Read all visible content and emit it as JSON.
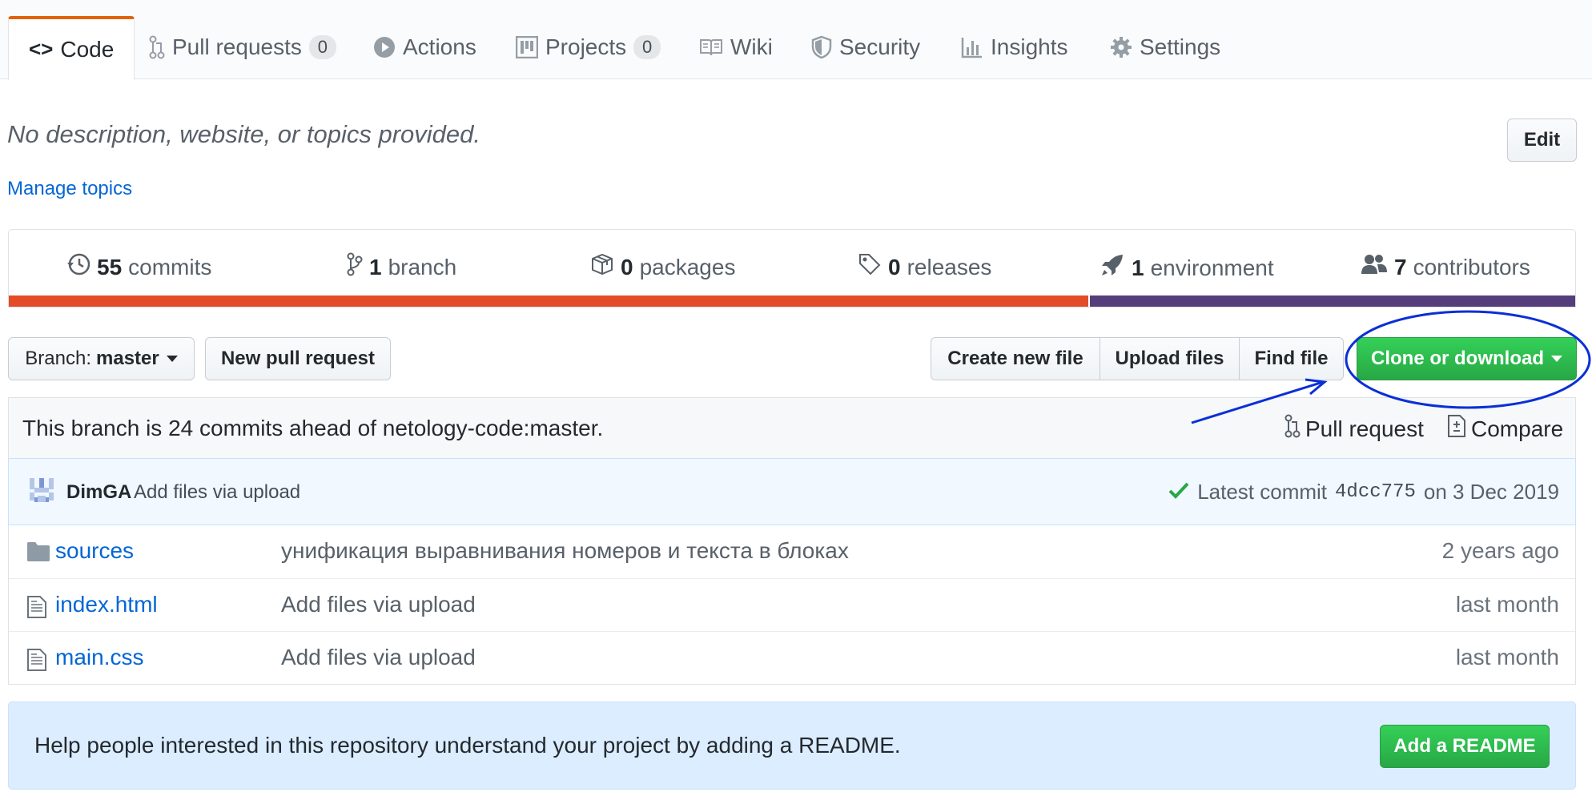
{
  "tabs": [
    {
      "label": "Code"
    },
    {
      "label": "Pull requests",
      "count": "0"
    },
    {
      "label": "Actions"
    },
    {
      "label": "Projects",
      "count": "0"
    },
    {
      "label": "Wiki"
    },
    {
      "label": "Security"
    },
    {
      "label": "Insights"
    },
    {
      "label": "Settings"
    }
  ],
  "repo": {
    "description": "No description, website, or topics provided.",
    "edit_label": "Edit",
    "manage_topics": "Manage topics"
  },
  "summary": {
    "commits": {
      "count": "55",
      "label": "commits"
    },
    "branches": {
      "count": "1",
      "label": "branch"
    },
    "packages": {
      "count": "0",
      "label": "packages"
    },
    "releases": {
      "count": "0",
      "label": "releases"
    },
    "environments": {
      "count": "1",
      "label": "environment"
    },
    "contributors": {
      "count": "7",
      "label": "contributors"
    },
    "languages": [
      {
        "color": "#e34c26",
        "share": 0.69
      },
      {
        "color": "#563d7c",
        "share": 0.31
      }
    ]
  },
  "actions": {
    "branch_prefix": "Branch:",
    "branch_name": "master",
    "new_pull_request": "New pull request",
    "create_new_file": "Create new file",
    "upload_files": "Upload files",
    "find_file": "Find file",
    "clone_or_download": "Clone or download"
  },
  "tracking": {
    "text": "This branch is 24 commits ahead of netology-code:master.",
    "pull_request": "Pull request",
    "compare": "Compare"
  },
  "commit": {
    "author": "DimGA",
    "message": "Add files via upload",
    "latest_prefix": "Latest commit",
    "sha": "4dcc775",
    "date": "on 3 Dec 2019"
  },
  "files": [
    {
      "type": "folder",
      "name": "sources",
      "message": "унификация выравнивания номеров и текста в блоках",
      "age": "2 years ago"
    },
    {
      "type": "file",
      "name": "index.html",
      "message": "Add files via upload",
      "age": "last month"
    },
    {
      "type": "file",
      "name": "main.css",
      "message": "Add files via upload",
      "age": "last month"
    }
  ],
  "readme_prompt": {
    "text": "Help people interested in this repository understand your project by adding a README.",
    "button": "Add a README"
  },
  "annotation": {
    "color": "#0b2fd6"
  }
}
